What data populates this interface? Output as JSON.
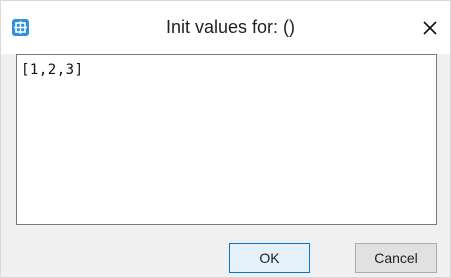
{
  "window": {
    "title": "Init values for: ()",
    "app_icon": "app-window-icon",
    "close_icon": "close-icon"
  },
  "editor": {
    "value": "[1,2,3]"
  },
  "buttons": {
    "ok_label": "OK",
    "cancel_label": "Cancel"
  },
  "colors": {
    "accent": "#0078d7",
    "icon": "#2f8fe0"
  }
}
